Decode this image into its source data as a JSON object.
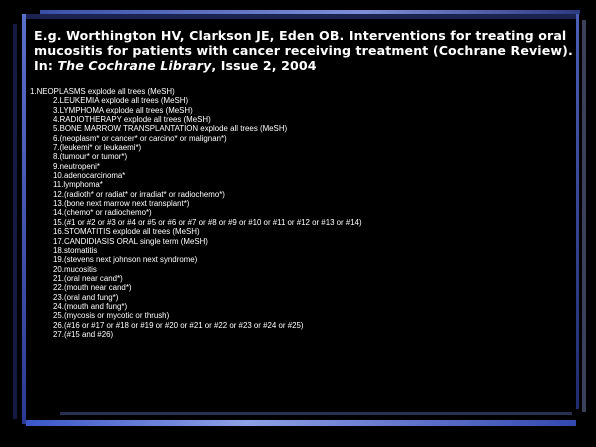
{
  "title": {
    "part1": "E.g. Worthington HV, Clarkson JE, Eden OB. Interventions for treating oral mucositis for patients with cancer receiving treatment (Cochrane Review). In: ",
    "italic": "The Cochrane Library",
    "part2": ", Issue 2, 2004"
  },
  "search_lines": [
    "1.NEOPLASMS explode all trees (MeSH)",
    "2.LEUKEMIA explode all trees (MeSH)",
    "3.LYMPHOMA explode all trees (MeSH)",
    "4.RADIOTHERAPY explode all trees (MeSH)",
    "5.BONE MARROW TRANSPLANTATION explode all trees (MeSH)",
    "6.(neoplasm* or cancer* or carcino* or malignan*)",
    "7.(leukemi* or leukaemi*)",
    "8.(tumour* or tumor*)",
    "9.neutropeni*",
    "10.adenocarcinoma*",
    "11.lymphoma*",
    "12.(radioth* or radiat* or irradiat* or radiochemo*)",
    "13.(bone next marrow next transplant*)",
    "14.(chemo* or radiochemo*)",
    "15.(#1 or #2 or #3 or #4 or #5 or #6 or #7 or #8 or #9 or #10 or #11 or #12 or #13 or #14)",
    "16.STOMATITIS explode all trees (MeSH)",
    "17.CANDIDIASIS ORAL single term (MeSH)",
    "18.stomatitis",
    "19.(stevens next johnson next syndrome)",
    "20.mucositis",
    "21.(oral near cand*)",
    "22.(mouth near cand*)",
    "23.(oral and fung*)",
    "24.(mouth and fung*)",
    "25.(mycosis or mycotic or thrush)",
    "26.(#16 or #17 or #18 or #19 or #20 or #21 or #22 or #23 or #24 or #25)",
    "27.(#15 and #26)"
  ]
}
